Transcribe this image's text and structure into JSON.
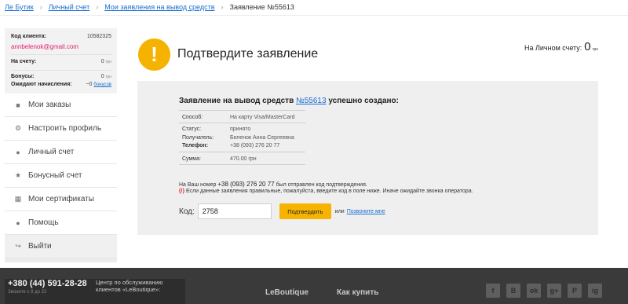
{
  "breadcrumb": {
    "items": [
      "Ле Бутик",
      "Личный счет",
      "Мои заявления на вывод средств"
    ],
    "current": "Заявление №55613",
    "separator": "›"
  },
  "account": {
    "client_code_label": "Код клиента:",
    "client_code": "10582325",
    "email": "annbelenok@gmail.com",
    "balance_label": "На счету:",
    "balance_value": "0",
    "currency": "грн",
    "bonuses_label": "Бонусы:",
    "bonuses_value": "0",
    "pending_label": "Ожидают начисления:",
    "pending_value": "~0",
    "pending_unit": "бонусов"
  },
  "menu": [
    {
      "label": "Мои заказы",
      "icon": "bag-icon"
    },
    {
      "label": "Настроить профиль",
      "icon": "gear-icon"
    },
    {
      "label": "Личный счет",
      "icon": "money-bag-icon"
    },
    {
      "label": "Бонусный счет",
      "icon": "star-icon"
    },
    {
      "label": "Мои сертификаты",
      "icon": "gift-icon"
    },
    {
      "label": "Помощь",
      "icon": "info-icon"
    },
    {
      "label": "Выйти",
      "icon": "logout-icon"
    }
  ],
  "main": {
    "title": "Подтвердите заявление",
    "balance_label": "На Личном счету:",
    "balance_value": "0",
    "balance_currency": "грн"
  },
  "panel": {
    "heading_prefix": "Заявление на вывод средств",
    "request_number": "№55613",
    "heading_suffix": "успешно создано:",
    "method_label": "Способ:",
    "method_value": "На карту Visa/MasterCard",
    "status_label": "Статус:",
    "status_value": "принято",
    "recipient_label": "Получатель:",
    "recipient_value": "Беленок Анна Сергеевна",
    "phone_label": "Телефон:",
    "phone_value": "+38 (093) 276 20 77",
    "amount_label": "Сумма:",
    "amount_value": "470.00 грн",
    "sms_prefix": "На Ваш номер",
    "sms_phone": "+38 (093) 276 20 77",
    "sms_suffix": "был отправлен код подтверждения.",
    "warning_mark": "(!)",
    "warning_text": "Если данные заявления правильные, пожалуйста, введите код в поле ниже. Иначе ожидайте звонка оператора.",
    "code_label": "Код:",
    "code_value": "2758",
    "confirm_button": "Подтвердить",
    "or_text": "или",
    "call_link": "Позвоните мне"
  },
  "footer": {
    "phone": "+380 (44) 591-28-28",
    "phone_sub": "Звоните с 8 до 22",
    "service_center": "Центр по обслуживанию клиентов «LeBoutique»:",
    "link_leboutique": "LeBoutique",
    "link_how_to_buy": "Как купить",
    "socials": [
      "f",
      "B",
      "ok",
      "g+",
      "P",
      "ig"
    ]
  },
  "colors": {
    "accent": "#f6b400",
    "email": "#e0206f",
    "link": "#1a6fd1",
    "footer_bg": "#3a3a3a"
  }
}
